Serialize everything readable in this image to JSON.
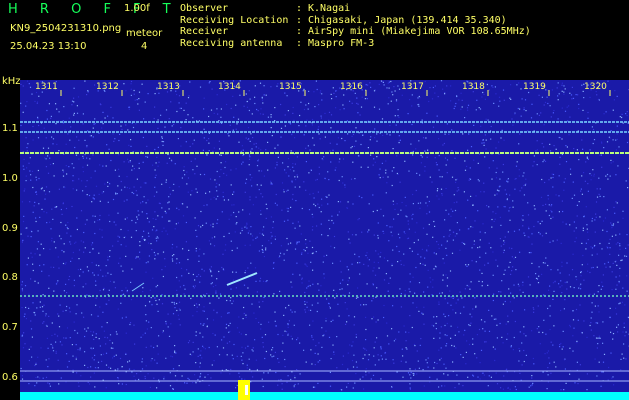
{
  "header": {
    "title": "H R O F F T",
    "version": "1.00f",
    "file_name": "KN9_2504231310.png",
    "type_label": "meteor",
    "timestamp": "25.04.23 13:10",
    "meteor_count": "4"
  },
  "info": [
    {
      "key": "Observer",
      "value": "K.Nagai"
    },
    {
      "key": "Receiving Location",
      "value": "Chigasaki, Japan (139.414 35.340)"
    },
    {
      "key": "Receiver",
      "value": "AirSpy mini (Miakejima VOR 108.65MHz)"
    },
    {
      "key": "Receiving antenna",
      "value": "Maspro FM-3"
    }
  ],
  "axis": {
    "y_unit": "kHz",
    "y_ticks": [
      "1.1",
      "1.0",
      "0.9",
      "0.8",
      "0.7",
      "0.6"
    ],
    "x_ticks": [
      "1311",
      "1312",
      "1313",
      "1314",
      "1315",
      "1316",
      "1317",
      "1318",
      "1319",
      "1320"
    ]
  },
  "colors": {
    "background": "#1a1aa8",
    "signal": "#ffff00",
    "baseline": "#00ffff",
    "text": "#ffff66",
    "title": "#16ff5a"
  }
}
